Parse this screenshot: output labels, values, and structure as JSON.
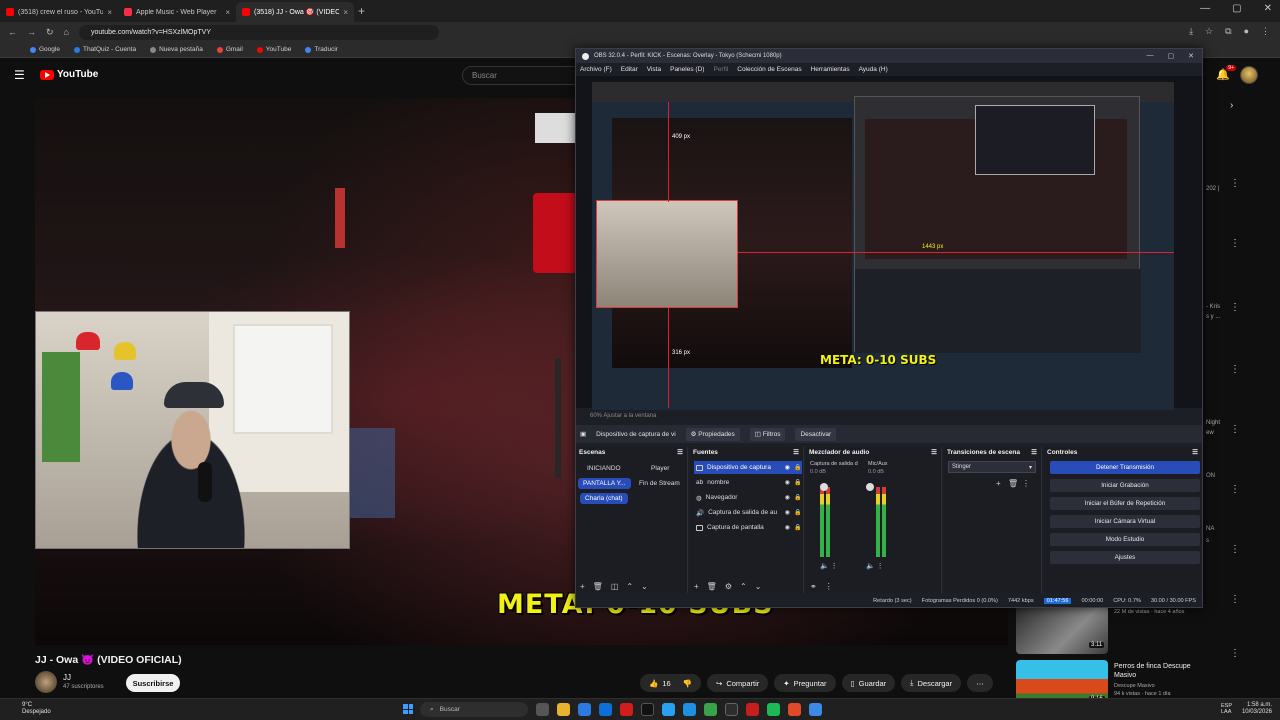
{
  "browser": {
    "tabs": [
      {
        "title": "(3518) crew el ruso - YouTube",
        "favicon": "youtube-icon",
        "active": false
      },
      {
        "title": "Apple Music - Web Player",
        "favicon": "music-icon",
        "active": false
      },
      {
        "title": "(3518) JJ - Owa 🎯 (VIDEO OFI",
        "favicon": "youtube-icon",
        "active": true
      }
    ],
    "url": "youtube.com/watch?v=HSXzlMOpTVY",
    "bookmarks": [
      "Google",
      "ThatQuiz - Cuenta",
      "Nueva pestaña",
      "Gmail",
      "YouTube",
      "Traducir"
    ]
  },
  "youtube": {
    "logo_text": "YouTube",
    "search_placeholder": "Buscar",
    "notification_count": "9+",
    "video_title": "JJ - Owa 😈 (VIDEO OFICIAL)",
    "channel_name": "JJ",
    "channel_subs": "47 suscriptores",
    "subscribe_label": "Suscribirse",
    "like_count": "16",
    "actions": [
      "Compartir",
      "Preguntar",
      "Guardar",
      "Descargar"
    ],
    "overlay_banner": "META: 0-10 SUBS",
    "recommendations": [
      {
        "title": "",
        "meta": "22 M de vistas · hace 4 años",
        "duration": "3:11"
      },
      {
        "title": "Perros de finca Descupe Masivo",
        "meta": "Descupe Masivo\n94 k vistas · hace 1 día",
        "duration": "9:16"
      }
    ],
    "side_snippets": [
      "202 |",
      "- Kris",
      "s y ...",
      "Night",
      "ew",
      "ON",
      "NA",
      "s"
    ]
  },
  "obs": {
    "title": "OBS 32.0.4 - Perfil: KICK - Escenas: Overlay - Tokyo (Schecmi 1080p)",
    "menu": [
      "Archivo (F)",
      "Editar",
      "Vista",
      "Paneles (D)",
      "Perfil",
      "Colección de Escenas",
      "Herramientas",
      "Ayuda (H)"
    ],
    "preview_labels": {
      "top_px": "409 px",
      "bottom_px": "316 px",
      "nested_px": "1443 px",
      "banner": "META: 0-10 SUBS"
    },
    "zoom_text": "60%   Ajustar a la ventana",
    "source_toolbar": {
      "selected_source": "Dispositivo de captura de vi",
      "properties": "Propiedades",
      "filters": "Filtros",
      "deactivate": "Desactivar"
    },
    "docks": {
      "scenes": "Escenas",
      "sources": "Fuentes",
      "mixer": "Mezclador de audio",
      "transitions": "Transiciones de escena",
      "controls": "Controles"
    },
    "scenes": [
      "INICIANDO",
      "Player",
      "PANTALLA Y...",
      "Fin de Stream",
      "Charla (chat)"
    ],
    "sources": [
      {
        "name": "Dispositivo de captura",
        "icon": "camera-icon",
        "selected": true
      },
      {
        "name": "nombre",
        "icon": "text-icon",
        "selected": false
      },
      {
        "name": "Navegador",
        "icon": "globe-icon",
        "selected": false
      },
      {
        "name": "Captura de salida de au",
        "icon": "speaker-icon",
        "selected": false
      },
      {
        "name": "Captura de pantalla",
        "icon": "monitor-icon",
        "selected": false
      }
    ],
    "mixer": {
      "ch1": "Captura de salida d",
      "ch2": "Mic/Aux",
      "db": "0.0 dB"
    },
    "transition": "Stinger",
    "controls": [
      "Detener Transmisión",
      "Iniciar Grabación",
      "Iniciar el Búfer de Repetición",
      "Iniciar Cámara Virtual",
      "Modo Estudio",
      "Ajustes"
    ],
    "status": {
      "delay": "Retardo (3 sec)",
      "dropped": "Fotogramas Perdidos 0 (0.0%)",
      "bitrate": "7442 kbps",
      "live_time": "01:47:56",
      "rec_time": "00:00:00",
      "cpu": "CPU: 0.7%",
      "fps": "30.00 / 30.00 FPS"
    }
  },
  "taskbar": {
    "weather_temp": "9°C",
    "weather_desc": "Despejado",
    "search_placeholder": "Buscar",
    "lang": "ESP\nLAA",
    "time": "1:58 a.m.",
    "date": "10/03/2026"
  }
}
